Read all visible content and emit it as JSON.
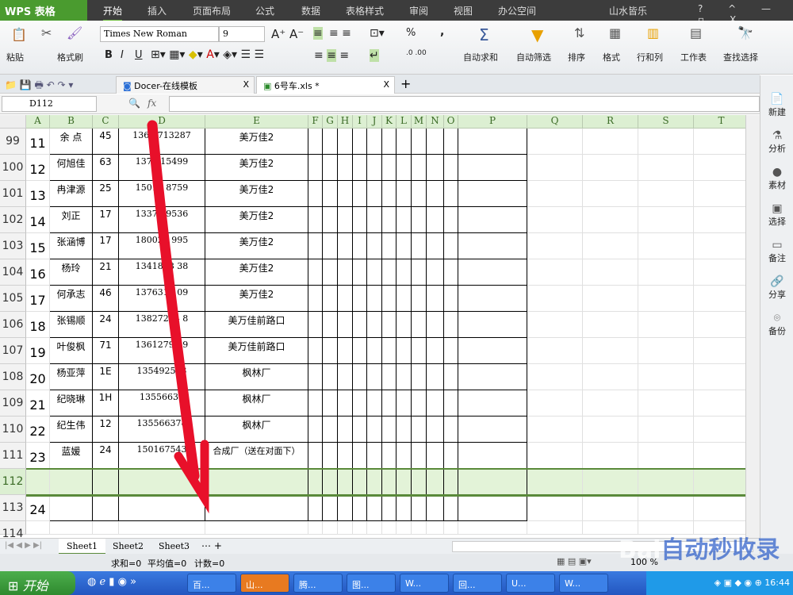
{
  "app": {
    "logo": "WPS 表格",
    "menus": [
      "开始",
      "插入",
      "页面布局",
      "公式",
      "数据",
      "表格样式",
      "审阅",
      "视图",
      "办公空间"
    ],
    "user": "山水皆乐",
    "window_controls": [
      "?",
      "^",
      "—",
      "▫",
      "X"
    ]
  },
  "ribbon": {
    "paste": "粘贴",
    "format_painter": "格式刷",
    "font": "Times New Roman",
    "size": "9",
    "bold": "B",
    "italic": "I",
    "underline": "U",
    "autosum": "自动求和",
    "autofilter": "自动筛选",
    "sort": "排序",
    "format": "格式",
    "rowcol": "行和列",
    "worksheet": "工作表",
    "find": "查找选择",
    "percent": "%",
    "comma": ","
  },
  "doc_tabs": [
    {
      "label": "Docer-在线模板"
    },
    {
      "label": "6号车.xls *"
    }
  ],
  "formula_bar": {
    "name_box": "D112",
    "fx": "fx",
    "value": ""
  },
  "columns": [
    "A",
    "B",
    "C",
    "D",
    "E",
    "F",
    "G",
    "H",
    "I",
    "J",
    "K",
    "L",
    "M",
    "N",
    "O",
    "P",
    "Q",
    "R",
    "S",
    "T"
  ],
  "rows": [
    {
      "n": "99",
      "a": "11",
      "b": "余 点",
      "c": "45",
      "d": "1361  713287",
      "e": "美万佳2"
    },
    {
      "n": "100",
      "a": "12",
      "b": "何旭佳",
      "c": "63",
      "d": "1376   15499",
      "e": "美万佳2"
    },
    {
      "n": "101",
      "a": "13",
      "b": "冉津源",
      "c": "25",
      "d": "15015   8759",
      "e": "美万佳2"
    },
    {
      "n": "102",
      "a": "14",
      "b": "刘正",
      "c": "17",
      "d": "13377   9536",
      "e": "美万佳2"
    },
    {
      "n": "103",
      "a": "15",
      "b": "张涵博",
      "c": "17",
      "d": "180027    995",
      "e": "美万佳2"
    },
    {
      "n": "104",
      "a": "16",
      "b": "杨玲",
      "c": "21",
      "d": "1341838   38",
      "e": "美万佳2"
    },
    {
      "n": "105",
      "a": "17",
      "b": "何承志",
      "c": "46",
      "d": "1376311   09",
      "e": "美万佳2"
    },
    {
      "n": "106",
      "a": "18",
      "b": "张锡顺",
      "c": "24",
      "d": "13827214   8",
      "e": "美万佳前路口"
    },
    {
      "n": "107",
      "a": "19",
      "b": "叶俊枫",
      "c": "71",
      "d": "13612792   9",
      "e": "美万佳前路口"
    },
    {
      "n": "108",
      "a": "20",
      "b": "杨亚萍",
      "c": "1E",
      "d": "135492593",
      "e": "枫林厂"
    },
    {
      "n": "109",
      "a": "21",
      "b": "纪晓琳",
      "c": "1H",
      "d": "13556637",
      "e": "枫林厂"
    },
    {
      "n": "110",
      "a": "22",
      "b": "纪生伟",
      "c": "12",
      "d": "135566378",
      "e": "枫林厂"
    },
    {
      "n": "111",
      "a": "23",
      "b": "蓝媛",
      "c": "24",
      "d": "150167543",
      "e": "合成厂（送在对面下）"
    },
    {
      "n": "112",
      "a": "",
      "b": "",
      "c": "",
      "d": "",
      "e": ""
    },
    {
      "n": "113",
      "a": "24",
      "b": "",
      "c": "",
      "d": "",
      "e": ""
    },
    {
      "n": "114",
      "a": "",
      "b": "",
      "c": "",
      "d": "",
      "e": ""
    }
  ],
  "selected_row": "112",
  "right_panel": [
    "新建",
    "分析",
    "素材",
    "选择",
    "备注",
    "分享",
    "备份"
  ],
  "sheets": [
    "Sheet1",
    "Sheet2",
    "Sheet3"
  ],
  "status": {
    "sum": "求和=0",
    "avg": "平均值=0",
    "count": "计数=0",
    "zoom": "100 %"
  },
  "taskbar": {
    "start": "开始",
    "tasks": [
      "百...",
      "山...",
      "腾...",
      "图...",
      "W...",
      "回...",
      "U...",
      "W..."
    ],
    "clock": "16:44"
  },
  "watermark": "Baidu经验 jingyan 自动秒收录"
}
